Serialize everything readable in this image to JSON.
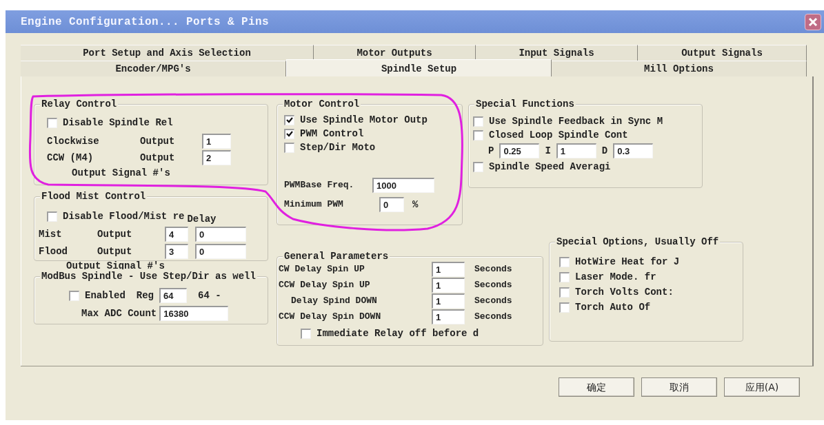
{
  "window": {
    "title": "Engine Configuration... Ports & Pins"
  },
  "tab_rows": [
    [
      {
        "label": "Port Setup and Axis Selection",
        "selected": false
      },
      {
        "label": "Motor Outputs",
        "selected": false
      },
      {
        "label": "Input Signals",
        "selected": false
      },
      {
        "label": "Output Signals",
        "selected": false
      }
    ],
    [
      {
        "label": "Encoder/MPG's",
        "selected": false
      },
      {
        "label": "Spindle Setup",
        "selected": true
      },
      {
        "label": "Mill Options",
        "selected": false
      }
    ]
  ],
  "relay_control": {
    "title": "Relay Control",
    "disable_checkbox": {
      "label": "Disable Spindle Rel",
      "checked": false
    },
    "outputs": [
      {
        "name": "Clockwise",
        "label": "Output",
        "value": "1"
      },
      {
        "name": "CCW (M4)",
        "label": "Output",
        "value": "2"
      }
    ],
    "footer": "Output Signal #'s"
  },
  "flood_mist_control": {
    "title": "Flood Mist Control",
    "disable_checkbox": {
      "label": "Disable Flood/Mist re",
      "checked": false
    },
    "delay_label": "Delay",
    "outputs": [
      {
        "name": "Mist",
        "label": "Output",
        "value": "4",
        "delay": "0"
      },
      {
        "name": "Flood",
        "label": "Output",
        "value": "3",
        "delay": "0"
      }
    ],
    "footer": "Output Signal #'s"
  },
  "modbus_spindle": {
    "title": "ModBus Spindle - Use Step/Dir as well",
    "enabled": {
      "label": "Enabled",
      "checked": false
    },
    "reg_label": "Reg",
    "reg_value": "64",
    "reg_suffix": "64 -",
    "max_adc_label": "Max ADC Count",
    "max_adc_value": "16380"
  },
  "motor_control": {
    "title": "Motor Control",
    "checkboxes": [
      {
        "label": "Use Spindle Motor Outp",
        "checked": true
      },
      {
        "label": "PWM Control",
        "checked": true
      },
      {
        "label": "Step/Dir Moto",
        "checked": false
      }
    ],
    "pwm_base_freq": {
      "label": "PWMBase Freq.",
      "value": "1000"
    },
    "minimum_pwm": {
      "label": "Minimum PWM",
      "value": "0",
      "unit": "%"
    }
  },
  "special_functions": {
    "title": "Special Functions",
    "checkboxes": [
      {
        "label": "Use Spindle Feedback in Sync M",
        "checked": false
      },
      {
        "label": "Closed Loop Spindle Cont",
        "checked": false
      }
    ],
    "pid": [
      {
        "label": "P",
        "value": "0.25"
      },
      {
        "label": "I",
        "value": "1"
      },
      {
        "label": "D",
        "value": "0.3"
      }
    ],
    "averaging": {
      "label": "Spindle Speed Averagi",
      "checked": false
    }
  },
  "general_parameters": {
    "title": "General Parameters",
    "rows": [
      {
        "label": "CW Delay Spin UP",
        "value": "1",
        "unit": "Seconds"
      },
      {
        "label": "CCW Delay Spin UP",
        "value": "1",
        "unit": "Seconds"
      },
      {
        "label": "Delay Spind DOWN",
        "value": "1",
        "unit": "Seconds"
      },
      {
        "label": "CCW Delay Spin DOWN",
        "value": "1",
        "unit": "Seconds"
      }
    ],
    "immediate_relay": {
      "label": "Immediate Relay off before d",
      "checked": false
    }
  },
  "special_options": {
    "title": "Special Options, Usually Off",
    "checkboxes": [
      {
        "label": "HotWire Heat for J",
        "checked": false
      },
      {
        "label": "Laser Mode. fr",
        "checked": false
      },
      {
        "label": "Torch Volts Cont:",
        "checked": false
      },
      {
        "label": "Torch Auto Of",
        "checked": false
      }
    ]
  },
  "buttons": [
    {
      "label": "确定"
    },
    {
      "label": "取消"
    },
    {
      "label": "应用(A)"
    }
  ]
}
